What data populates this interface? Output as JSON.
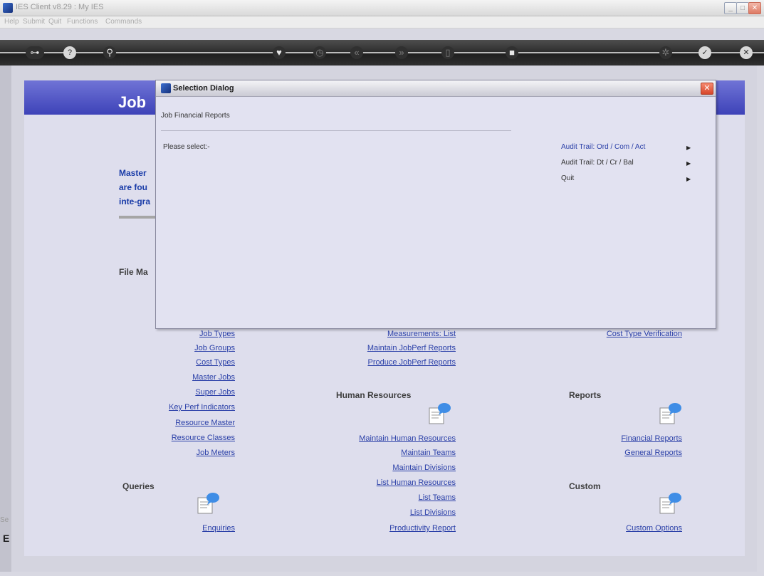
{
  "window": {
    "title": "IES Client v8.29 : My IES",
    "minimize": "_",
    "maximize": "□",
    "close": "✕"
  },
  "menu": [
    "Help",
    "Submit",
    "Quit",
    "Functions",
    "Commands"
  ],
  "toolbar": {
    "icons": [
      "key-icon",
      "help-icon",
      "search-icon",
      "heart-icon",
      "clock-icon",
      "rewind-icon",
      "forward-icon",
      "stop-icon",
      "square-icon",
      "settings-icon",
      "check-icon",
      "close-icon"
    ]
  },
  "header": {
    "title": "Job"
  },
  "intro": {
    "lines": [
      "Master",
      "are fou",
      "inte-gra"
    ]
  },
  "sections": {
    "file": "File Ma",
    "human_resources": "Human Resources",
    "reports": "Reports",
    "queries": "Queries",
    "custom": "Custom"
  },
  "links": {
    "col1": [
      "Job Types",
      "Job Groups",
      "Cost Types",
      "Master Jobs",
      "Super Jobs",
      "Key Perf Indicators",
      "Resource Master",
      "Resource Classes",
      "Job Meters"
    ],
    "col2_top": [
      "Measurements: List",
      "Maintain JobPerf Reports",
      "Produce JobPerf Reports"
    ],
    "col2_hr": [
      "Maintain Human Resources",
      "Maintain Teams",
      "Maintain Divisions",
      "List Human Resources",
      "List Teams",
      "List Divisions",
      "Productivity Report"
    ],
    "col3_top": [
      "Cost Type Verification"
    ],
    "col3_reports": [
      "Financial Reports",
      "General Reports"
    ],
    "queries": [
      "Enquiries"
    ],
    "custom": [
      "Custom Options"
    ]
  },
  "dialog": {
    "title": "Selection Dialog",
    "subtitle": "Job Financial Reports",
    "prompt": "Please select:-",
    "options": [
      "Audit Trail: Ord / Com / Act",
      "Audit Trail: Dt / Cr / Bal",
      "Quit"
    ],
    "close": "✕"
  },
  "bottom": {
    "status": "Se",
    "letter": "E"
  }
}
